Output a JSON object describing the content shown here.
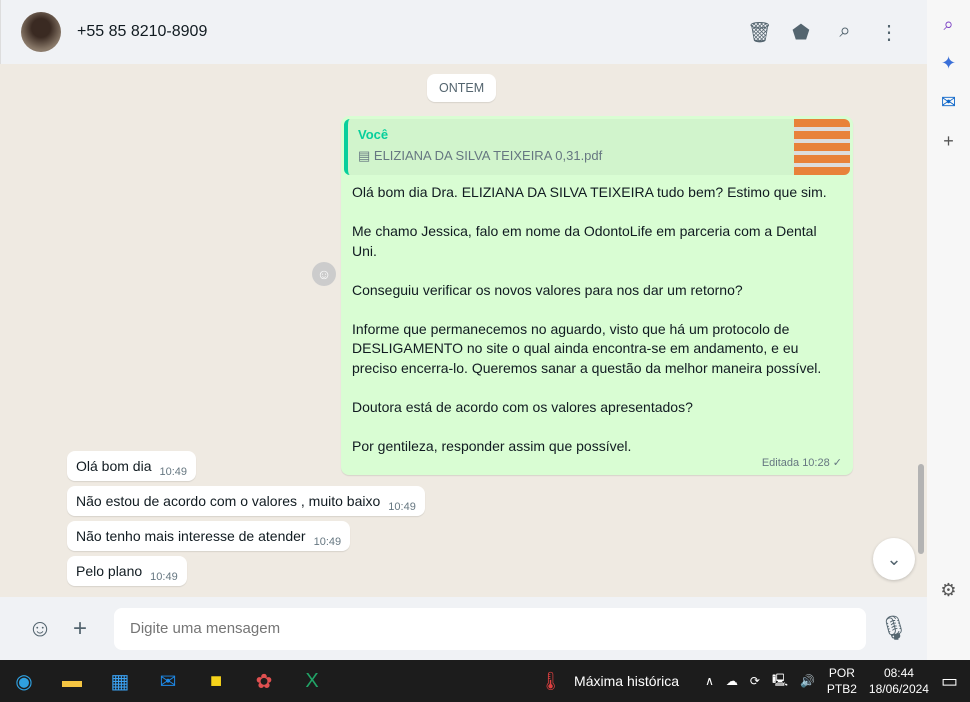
{
  "header": {
    "contact": "+55 85 8210-8909"
  },
  "chat": {
    "date": "ONTEM",
    "outgoing": {
      "quote_author": "Você",
      "quote_file": "ELIZIANA DA SILVA TEIXEIRA 0,31.pdf",
      "text": "Olá bom dia Dra. ELIZIANA DA SILVA TEIXEIRA tudo bem? Estimo que sim.\n\nMe chamo Jessica, falo em nome da OdontoLife em parceria com a Dental Uni.\n\nConseguiu verificar os novos valores para nos dar um retorno?\n\nInforme que permanecemos no aguardo, visto que há um protocolo de DESLIGAMENTO no site o qual ainda encontra-se em andamento, e eu preciso encerra-lo. Queremos sanar a questão da melhor maneira possível.\n\nDoutora está de acordo com os valores apresentados?\n\nPor gentileza, responder assim que possível.",
      "meta": "Editada 10:28 ✓"
    },
    "incoming": [
      {
        "text": "Olá bom dia",
        "time": "10:49"
      },
      {
        "text": "Não estou de acordo com o valores , muito baixo",
        "time": "10:49"
      },
      {
        "text": "Não tenho mais interesse de atender",
        "time": "10:49"
      },
      {
        "text": "Pelo plano",
        "time": "10:49"
      }
    ]
  },
  "footer": {
    "placeholder": "Digite uma mensagem"
  },
  "taskbar": {
    "weather": "Máxima histórica",
    "lang1": "POR",
    "lang2": "PTB2",
    "time": "08:44",
    "date": "18/06/2024"
  }
}
